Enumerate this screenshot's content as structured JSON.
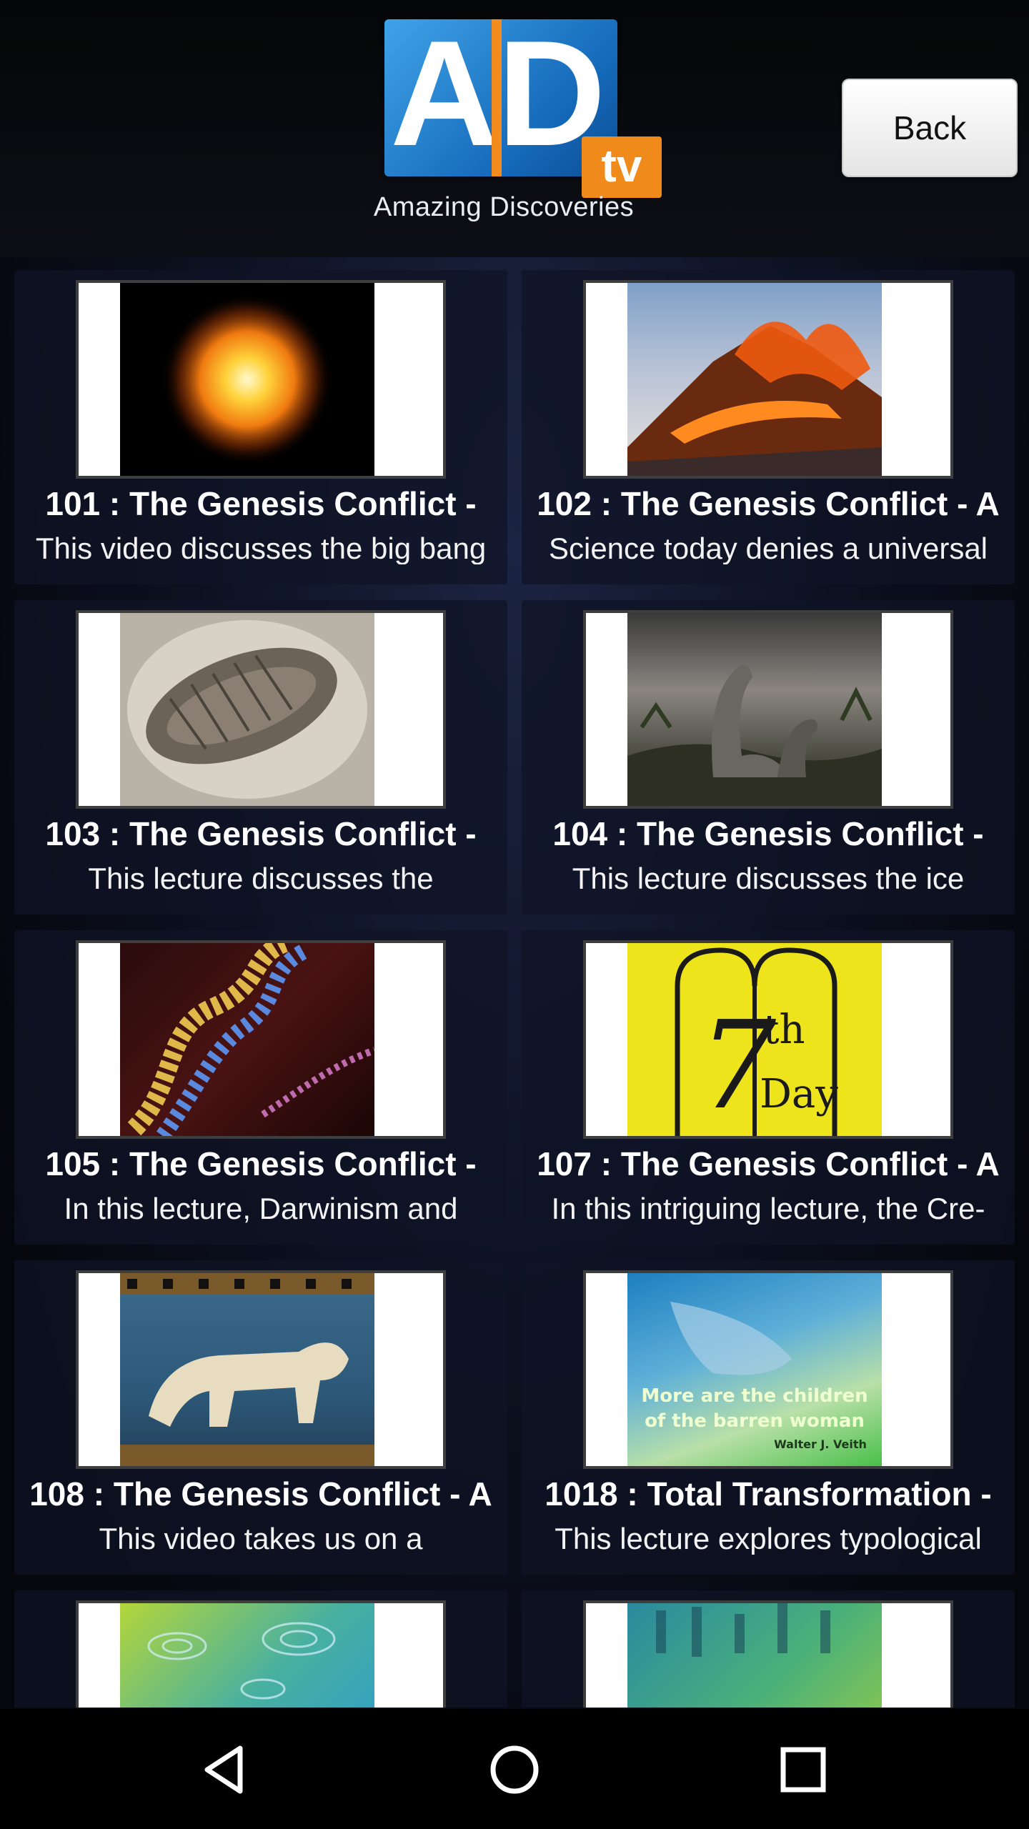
{
  "header": {
    "logo_letters": "AD",
    "logo_badge": "tv",
    "logo_tagline": "Amazing Discoveries",
    "back_label": "Back"
  },
  "videos": [
    {
      "title": "101 : The Genesis Conflict -",
      "description": "This video discusses the big bang",
      "thumb": "exploding-star"
    },
    {
      "title": "102 : The Genesis Conflict - A",
      "description": "Science today denies a universal",
      "thumb": "volcano-eruption"
    },
    {
      "title": "103 : The Genesis Conflict -",
      "description": "This lecture discusses the",
      "thumb": "trilobite-fossil"
    },
    {
      "title": "104 : The Genesis Conflict -",
      "description": "This lecture discusses the ice",
      "thumb": "dinosaurs"
    },
    {
      "title": "105 : The Genesis Conflict -",
      "description": "In this lecture, Darwinism and",
      "thumb": "dna-helix"
    },
    {
      "title": "107 : The Genesis Conflict - A",
      "description": "In this intriguing lecture, the Cre-",
      "thumb": "seventh-day-tablets"
    },
    {
      "title": "108 : The Genesis Conflict - A",
      "description": "This video takes us on a",
      "thumb": "babylon-lion-mosaic"
    },
    {
      "title": "1018 : Total Transformation -",
      "description": "This lecture explores typological",
      "thumb": "hands-barren-woman",
      "thumb_text": [
        "More are the children",
        "of the barren woman",
        "Walter J. Veith"
      ]
    },
    {
      "title": "",
      "description": "",
      "thumb": "water-ripples"
    },
    {
      "title": "",
      "description": "",
      "thumb": "crowd-walking"
    }
  ],
  "navigation": {
    "back_icon": "triangle-back-icon",
    "home_icon": "circle-home-icon",
    "recents_icon": "square-recents-icon"
  },
  "colors": {
    "logo_blue": "#1f7fd0",
    "logo_orange": "#f08a1a",
    "card_bg": "#0f1426"
  }
}
